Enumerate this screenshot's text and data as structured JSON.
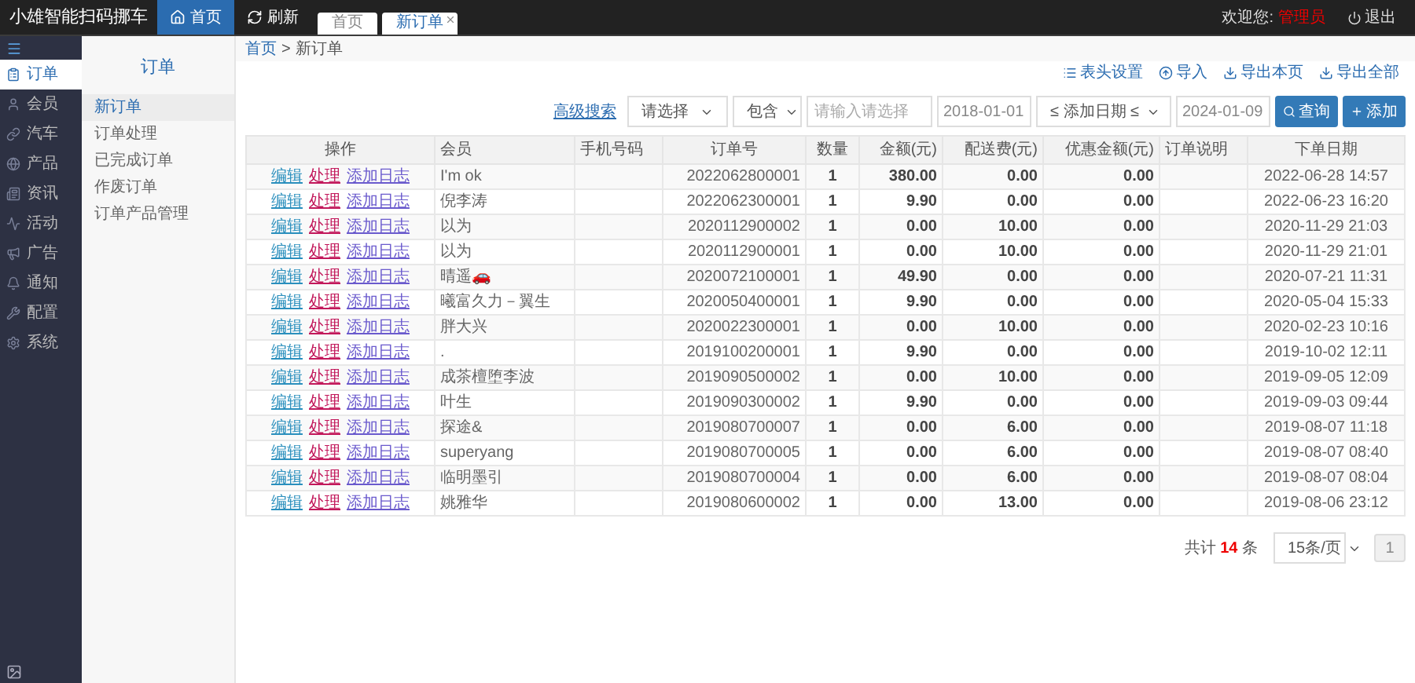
{
  "app_title": "小雄智能扫码挪车",
  "nav": [
    {
      "label": "首页",
      "selected": true
    },
    {
      "label": "刷新",
      "selected": false
    }
  ],
  "page_tabs": [
    {
      "label": "首页",
      "selected": false,
      "closable": false
    },
    {
      "label": "新订单",
      "selected": true,
      "closable": true
    }
  ],
  "user": {
    "greeting": "欢迎您:",
    "name": "管理员",
    "logout": "退出"
  },
  "sidebar": {
    "items": [
      {
        "label": "订单",
        "selected": true
      },
      {
        "label": "会员",
        "selected": false
      },
      {
        "label": "汽车",
        "selected": false
      },
      {
        "label": "产品",
        "selected": false
      },
      {
        "label": "资讯",
        "selected": false
      },
      {
        "label": "活动",
        "selected": false
      },
      {
        "label": "广告",
        "selected": false
      },
      {
        "label": "通知",
        "selected": false
      },
      {
        "label": "配置",
        "selected": false
      },
      {
        "label": "系统",
        "selected": false
      }
    ]
  },
  "submenu": {
    "title": "订单",
    "items": [
      {
        "label": "新订单",
        "selected": true
      },
      {
        "label": "订单处理",
        "selected": false
      },
      {
        "label": "已完成订单",
        "selected": false
      },
      {
        "label": "作废订单",
        "selected": false
      },
      {
        "label": "订单产品管理",
        "selected": false
      }
    ]
  },
  "breadcrumb": [
    "首页",
    ">",
    "新订单"
  ],
  "toolbar": [
    {
      "label": "表头设置"
    },
    {
      "label": "导入"
    },
    {
      "label": "导出本页"
    },
    {
      "label": "导出全部"
    }
  ],
  "filters": {
    "advanced": "高级搜索",
    "field": "请选择",
    "operator": "包含",
    "keyword_placeholder": "请输入请选择",
    "date_from": "2018-01-01",
    "date_field": "≤ 添加日期 ≤",
    "date_to": "2024-01-09",
    "search": "查询",
    "add": "添加"
  },
  "table": {
    "columns": [
      "操作",
      "会员",
      "手机号码",
      "订单号",
      "数量",
      "金额(元)",
      "配送费(元)",
      "优惠金额(元)",
      "订单说明",
      "下单日期"
    ],
    "rows": [
      {
        "actions": [
          "编辑",
          "处理",
          "添加日志"
        ],
        "member": "I'm ok",
        "order_no": "2022062800001",
        "qty": "1",
        "amount": "380.00",
        "delivery": "0.00",
        "discount": "0.00",
        "date": "2022-06-28 14:57"
      },
      {
        "actions": [
          "编辑",
          "处理",
          "添加日志"
        ],
        "member": "倪李涛",
        "order_no": "2022062300001",
        "qty": "1",
        "amount": "9.90",
        "delivery": "0.00",
        "discount": "0.00",
        "date": "2022-06-23 16:20"
      },
      {
        "actions": [
          "编辑",
          "处理",
          "添加日志"
        ],
        "member": "以为",
        "order_no": "2020112900002",
        "qty": "1",
        "amount": "0.00",
        "delivery": "10.00",
        "discount": "0.00",
        "date": "2020-11-29 21:03"
      },
      {
        "actions": [
          "编辑",
          "处理",
          "添加日志"
        ],
        "member": "以为",
        "order_no": "2020112900001",
        "qty": "1",
        "amount": "0.00",
        "delivery": "10.00",
        "discount": "0.00",
        "date": "2020-11-29 21:01"
      },
      {
        "actions": [
          "编辑",
          "处理",
          "添加日志"
        ],
        "member": "晴遥🚗",
        "order_no": "2020072100001",
        "qty": "1",
        "amount": "49.90",
        "delivery": "0.00",
        "discount": "0.00",
        "date": "2020-07-21 11:31"
      },
      {
        "actions": [
          "编辑",
          "处理",
          "添加日志"
        ],
        "member": "曦富久力－翼生",
        "order_no": "2020050400001",
        "qty": "1",
        "amount": "9.90",
        "delivery": "0.00",
        "discount": "0.00",
        "date": "2020-05-04 15:33"
      },
      {
        "actions": [
          "编辑",
          "处理",
          "添加日志"
        ],
        "member": "胖大兴",
        "order_no": "2020022300001",
        "qty": "1",
        "amount": "0.00",
        "delivery": "10.00",
        "discount": "0.00",
        "date": "2020-02-23 10:16"
      },
      {
        "actions": [
          "编辑",
          "处理",
          "添加日志"
        ],
        "member": ".",
        "order_no": "2019100200001",
        "qty": "1",
        "amount": "9.90",
        "delivery": "0.00",
        "discount": "0.00",
        "date": "2019-10-02 12:11"
      },
      {
        "actions": [
          "编辑",
          "处理",
          "添加日志"
        ],
        "member": "成茶檀堕李波",
        "order_no": "2019090500002",
        "qty": "1",
        "amount": "0.00",
        "delivery": "10.00",
        "discount": "0.00",
        "date": "2019-09-05 12:09"
      },
      {
        "actions": [
          "编辑",
          "处理",
          "添加日志"
        ],
        "member": "叶生",
        "order_no": "2019090300002",
        "qty": "1",
        "amount": "9.90",
        "delivery": "0.00",
        "discount": "0.00",
        "date": "2019-09-03 09:44"
      },
      {
        "actions": [
          "编辑",
          "处理",
          "添加日志"
        ],
        "member": "探途&",
        "order_no": "2019080700007",
        "qty": "1",
        "amount": "0.00",
        "delivery": "6.00",
        "discount": "0.00",
        "date": "2019-08-07 11:18"
      },
      {
        "actions": [
          "编辑",
          "处理",
          "添加日志"
        ],
        "member": "superyang",
        "order_no": "2019080700005",
        "qty": "1",
        "amount": "0.00",
        "delivery": "6.00",
        "discount": "0.00",
        "date": "2019-08-07 08:40"
      },
      {
        "actions": [
          "编辑",
          "处理",
          "添加日志"
        ],
        "member": "临明墨引",
        "order_no": "2019080700004",
        "qty": "1",
        "amount": "0.00",
        "delivery": "6.00",
        "discount": "0.00",
        "date": "2019-08-07 08:04"
      },
      {
        "actions": [
          "编辑",
          "处理",
          "添加日志"
        ],
        "member": "姚雅华",
        "order_no": "2019080600002",
        "qty": "1",
        "amount": "0.00",
        "delivery": "13.00",
        "discount": "0.00",
        "date": "2019-08-06 23:12"
      }
    ]
  },
  "pagination": {
    "total_prefix": "共计",
    "total": "14",
    "total_suffix": "条",
    "page_size": "15条/页",
    "pages": [
      {
        "label": "1",
        "selected": true
      }
    ]
  }
}
